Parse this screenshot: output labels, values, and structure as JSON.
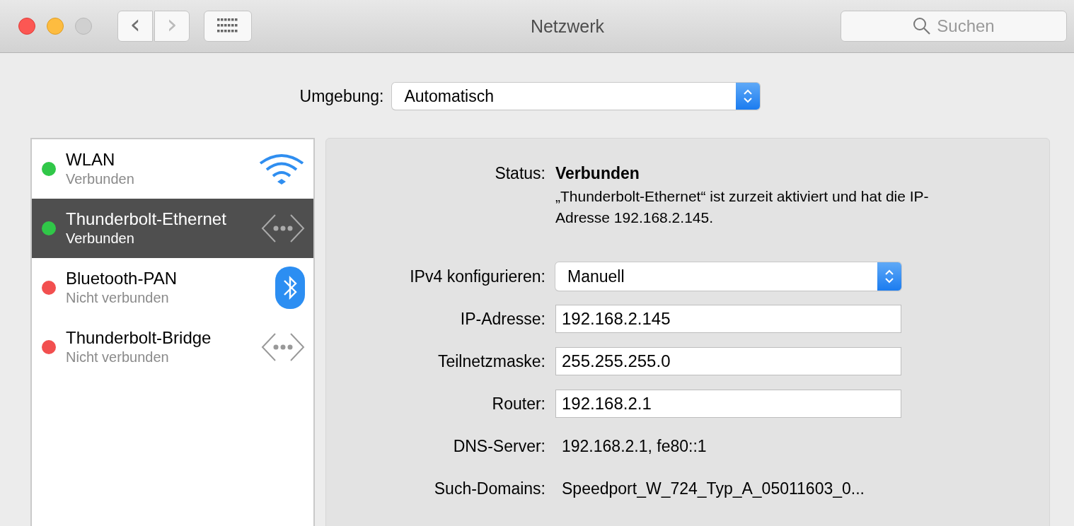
{
  "window": {
    "title": "Netzwerk"
  },
  "toolbar": {
    "back": {
      "label": "‹",
      "disabled": false
    },
    "forward": {
      "label": "›",
      "disabled": true
    },
    "search": {
      "placeholder": "Suchen"
    }
  },
  "location": {
    "label": "Umgebung:",
    "value": "Automatisch"
  },
  "services": [
    {
      "name": "WLAN",
      "status": "Verbunden",
      "color": "#30c748",
      "selected": false,
      "kind": "wifi"
    },
    {
      "name": "Thunderbolt-Ethernet",
      "status": "Verbunden",
      "color": "#30c748",
      "selected": true,
      "kind": "ethernet"
    },
    {
      "name": "Bluetooth-PAN",
      "status": "Nicht verbunden",
      "color": "#f24f4f",
      "selected": false,
      "kind": "bluetooth"
    },
    {
      "name": "Thunderbolt-Bridge",
      "status": "Nicht verbunden",
      "color": "#f24f4f",
      "selected": false,
      "kind": "ethernet"
    }
  ],
  "details": {
    "status_label": "Status:",
    "status_value": "Verbunden",
    "description": "„Thunderbolt-Ethernet“ ist zurzeit aktiviert und hat die IP-Adresse 192.168.2.145.",
    "fields": [
      {
        "label": "IPv4 konfigurieren:",
        "value": "Manuell",
        "kind": "select"
      },
      {
        "label": "IP-Adresse:",
        "value": "192.168.2.145",
        "kind": "input"
      },
      {
        "label": "Teilnetzmaske:",
        "value": "255.255.255.0",
        "kind": "input"
      },
      {
        "label": "Router:",
        "value": "192.168.2.1",
        "kind": "input"
      },
      {
        "label": "DNS-Server:",
        "value": "192.168.2.1, fe80::1",
        "kind": "text"
      },
      {
        "label": "Such-Domains:",
        "value": "Speedport_W_724_Typ_A_05011603_0...",
        "kind": "text"
      }
    ]
  }
}
